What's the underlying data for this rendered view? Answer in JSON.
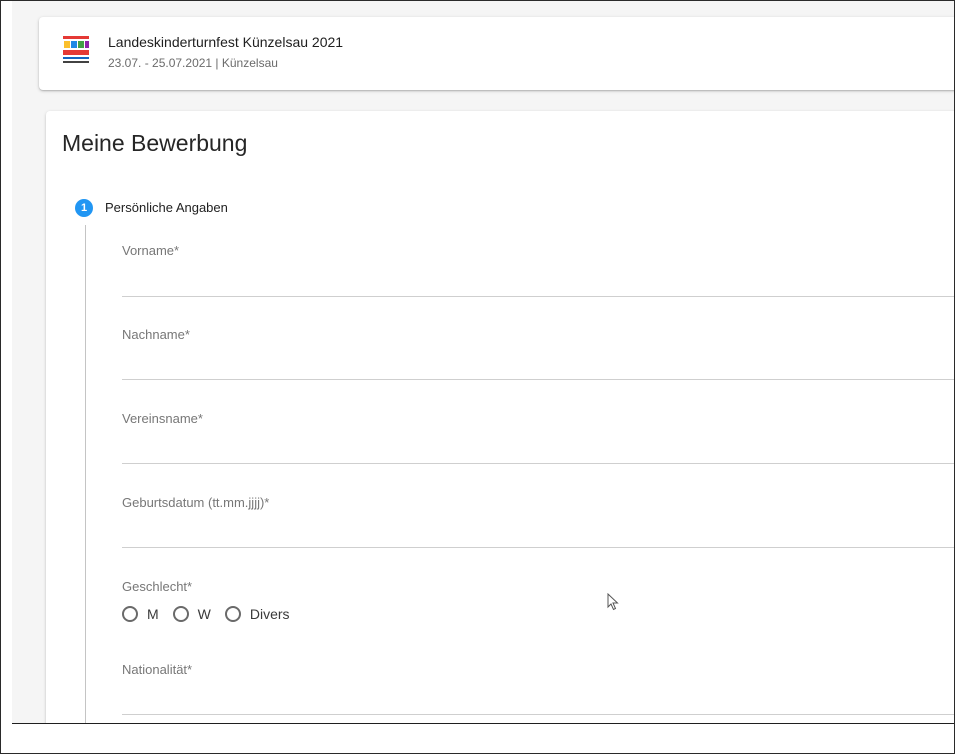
{
  "event": {
    "logo_text": "LANDES TURN FEST",
    "title": "Landeskinderturnfest Künzelsau 2021",
    "subtitle": "23.07. - 25.07.2021 | Künzelsau"
  },
  "page": {
    "title": "Meine Bewerbung"
  },
  "stepper": {
    "step_number": "1",
    "step_label": "Persönliche Angaben"
  },
  "fields": {
    "vorname": {
      "label": "Vorname*",
      "value": ""
    },
    "nachname": {
      "label": "Nachname*",
      "value": ""
    },
    "vereinsname": {
      "label": "Vereinsname*",
      "value": ""
    },
    "geburtsdatum": {
      "label": "Geburtsdatum (tt.mm.jjjj)*",
      "value": ""
    },
    "nationalitaet": {
      "label": "Nationalität*",
      "value": ""
    }
  },
  "gender": {
    "label": "Geschlecht*",
    "options": [
      "M",
      "W",
      "Divers"
    ]
  },
  "colors": {
    "accent": "#2196f3",
    "background": "#f5f5f5"
  }
}
